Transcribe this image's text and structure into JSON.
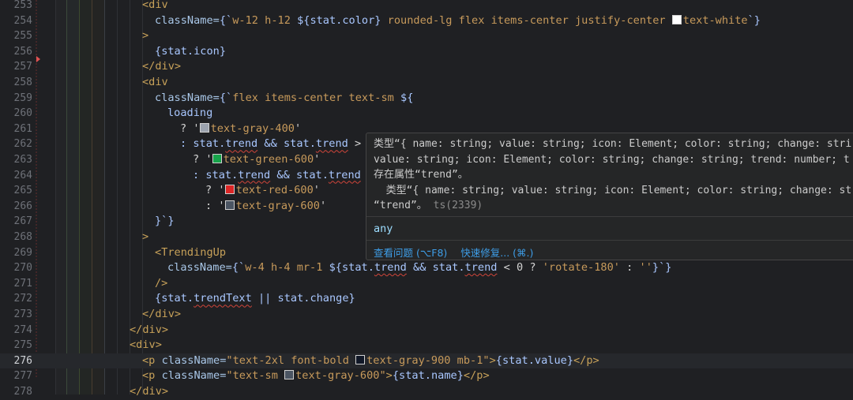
{
  "colors": {
    "editor_bg": "#1f2023",
    "tag": "#c7a159",
    "attr": "#a9c7e8",
    "string": "#c79a5b",
    "variable": "#a9c7ff",
    "error": "#d1453a",
    "link": "#3e9ee8"
  },
  "editor": {
    "active_line": 276,
    "lines": [
      {
        "no": "253",
        "segments": [
          {
            "t": "<div",
            "c": "tag"
          }
        ],
        "indent": 180
      },
      {
        "no": "254",
        "segments": [
          {
            "t": "className=",
            "c": "attr"
          },
          {
            "t": "{`",
            "c": "brace"
          },
          {
            "t": "w-12 h-12 ",
            "c": "str"
          },
          {
            "t": "${",
            "c": "brace"
          },
          {
            "t": "stat.color",
            "c": "var"
          },
          {
            "t": "}",
            "c": "brace"
          },
          {
            "t": " rounded-lg flex items-center justify-center ",
            "c": "str"
          },
          {
            "t": "",
            "c": "swatch",
            "swatch": "#ffffff"
          },
          {
            "t": "text-white",
            "c": "str"
          },
          {
            "t": "`}",
            "c": "brace"
          }
        ],
        "indent": 196
      },
      {
        "no": "255",
        "segments": [
          {
            "t": ">",
            "c": "tag"
          }
        ],
        "indent": 180
      },
      {
        "no": "256",
        "segments": [
          {
            "t": "{",
            "c": "brace"
          },
          {
            "t": "stat.icon",
            "c": "var"
          },
          {
            "t": "}",
            "c": "brace"
          }
        ],
        "indent": 196
      },
      {
        "no": "257",
        "segments": [
          {
            "t": "</div>",
            "c": "tag"
          }
        ],
        "indent": 180
      },
      {
        "no": "258",
        "segments": [
          {
            "t": "<div",
            "c": "tag"
          }
        ],
        "indent": 180
      },
      {
        "no": "259",
        "segments": [
          {
            "t": "className=",
            "c": "attr"
          },
          {
            "t": "{`",
            "c": "brace"
          },
          {
            "t": "flex items-center text-sm ",
            "c": "str"
          },
          {
            "t": "${",
            "c": "brace"
          }
        ],
        "indent": 196
      },
      {
        "no": "260",
        "segments": [
          {
            "t": "loading",
            "c": "var"
          }
        ],
        "indent": 212
      },
      {
        "no": "261",
        "segments": [
          {
            "t": "? '",
            "c": "plain"
          },
          {
            "t": "",
            "c": "swatch",
            "swatch": "#9ca3af"
          },
          {
            "t": "text-gray-400",
            "c": "str"
          },
          {
            "t": "'",
            "c": "plain"
          }
        ],
        "indent": 228
      },
      {
        "no": "262",
        "segments": [
          {
            "t": ": stat.",
            "c": "var"
          },
          {
            "t": "trend",
            "c": "var",
            "sq": true
          },
          {
            "t": " && stat.",
            "c": "var"
          },
          {
            "t": "trend",
            "c": "var",
            "sq": true
          },
          {
            "t": " > 0",
            "c": "plain"
          }
        ],
        "indent": 228
      },
      {
        "no": "263",
        "segments": [
          {
            "t": "? '",
            "c": "plain"
          },
          {
            "t": "",
            "c": "swatch",
            "swatch": "#16a34a"
          },
          {
            "t": "text-green-600",
            "c": "str"
          },
          {
            "t": "'",
            "c": "plain"
          }
        ],
        "indent": 244
      },
      {
        "no": "264",
        "segments": [
          {
            "t": ": stat.",
            "c": "var"
          },
          {
            "t": "trend",
            "c": "var",
            "sq": true
          },
          {
            "t": " && stat.",
            "c": "var"
          },
          {
            "t": "trend",
            "c": "var",
            "sq": true
          },
          {
            "t": " <",
            "c": "plain"
          }
        ],
        "indent": 244
      },
      {
        "no": "265",
        "segments": [
          {
            "t": "? '",
            "c": "plain"
          },
          {
            "t": "",
            "c": "swatch",
            "swatch": "#dc2626"
          },
          {
            "t": "text-red-600",
            "c": "str"
          },
          {
            "t": "'",
            "c": "plain"
          }
        ],
        "indent": 260
      },
      {
        "no": "266",
        "segments": [
          {
            "t": ": '",
            "c": "plain"
          },
          {
            "t": "",
            "c": "swatch",
            "swatch": "#4b5563"
          },
          {
            "t": "text-gray-600",
            "c": "str"
          },
          {
            "t": "'",
            "c": "plain"
          }
        ],
        "indent": 260
      },
      {
        "no": "267",
        "segments": [
          {
            "t": "}`}",
            "c": "brace"
          }
        ],
        "indent": 196
      },
      {
        "no": "268",
        "segments": [
          {
            "t": ">",
            "c": "tag"
          }
        ],
        "indent": 180
      },
      {
        "no": "269",
        "segments": [
          {
            "t": "<TrendingUp",
            "c": "tag"
          }
        ],
        "indent": 196
      },
      {
        "no": "270",
        "segments": [
          {
            "t": "className=",
            "c": "attr"
          },
          {
            "t": "{`",
            "c": "brace"
          },
          {
            "t": "w-4 h-4 mr-1 ",
            "c": "str"
          },
          {
            "t": "${",
            "c": "brace"
          },
          {
            "t": "stat.",
            "c": "var"
          },
          {
            "t": "trend",
            "c": "var",
            "sq": true
          },
          {
            "t": " && stat.",
            "c": "var"
          },
          {
            "t": "trend",
            "c": "var",
            "sq": true
          },
          {
            "t": " < 0 ? ",
            "c": "plain"
          },
          {
            "t": "'rotate-180'",
            "c": "str"
          },
          {
            "t": " : ",
            "c": "plain"
          },
          {
            "t": "''",
            "c": "str"
          },
          {
            "t": "}`}",
            "c": "brace"
          }
        ],
        "indent": 212
      },
      {
        "no": "271",
        "segments": [
          {
            "t": "/>",
            "c": "tag"
          }
        ],
        "indent": 196
      },
      {
        "no": "272",
        "segments": [
          {
            "t": "{",
            "c": "brace"
          },
          {
            "t": "stat.",
            "c": "var"
          },
          {
            "t": "trendText",
            "c": "var",
            "sq": true
          },
          {
            "t": " || stat.change",
            "c": "var"
          },
          {
            "t": "}",
            "c": "brace"
          }
        ],
        "indent": 196
      },
      {
        "no": "273",
        "segments": [
          {
            "t": "</div>",
            "c": "tag"
          }
        ],
        "indent": 180
      },
      {
        "no": "274",
        "segments": [
          {
            "t": "</div>",
            "c": "tag"
          }
        ],
        "indent": 164
      },
      {
        "no": "275",
        "segments": [
          {
            "t": "<div>",
            "c": "tag"
          }
        ],
        "indent": 164
      },
      {
        "no": "276",
        "segments": [
          {
            "t": "<p ",
            "c": "tag"
          },
          {
            "t": "className=",
            "c": "attr"
          },
          {
            "t": "\"text-2xl font-bold ",
            "c": "str"
          },
          {
            "t": "",
            "c": "swatch",
            "swatch": "#111827"
          },
          {
            "t": "text-gray-900 mb-1\"",
            "c": "str"
          },
          {
            "t": ">",
            "c": "tag"
          },
          {
            "t": "{",
            "c": "brace"
          },
          {
            "t": "stat.value",
            "c": "var"
          },
          {
            "t": "}",
            "c": "brace"
          },
          {
            "t": "</p>",
            "c": "tag"
          }
        ],
        "indent": 180
      },
      {
        "no": "277",
        "segments": [
          {
            "t": "<p ",
            "c": "tag"
          },
          {
            "t": "className=",
            "c": "attr"
          },
          {
            "t": "\"text-sm ",
            "c": "str"
          },
          {
            "t": "",
            "c": "swatch",
            "swatch": "#4b5563"
          },
          {
            "t": "text-gray-600\"",
            "c": "str"
          },
          {
            "t": ">",
            "c": "tag"
          },
          {
            "t": "{",
            "c": "brace"
          },
          {
            "t": "stat.name",
            "c": "var"
          },
          {
            "t": "}",
            "c": "brace"
          },
          {
            "t": "</p>",
            "c": "tag"
          }
        ],
        "indent": 180
      },
      {
        "no": "278",
        "segments": [
          {
            "t": "</div>",
            "c": "tag"
          }
        ],
        "indent": 164
      }
    ]
  },
  "hover": {
    "line1": "类型“{ name: string; value: string; icon: Element; color: string; change: stri",
    "line2": "value: string; icon: Element; color: string; change: string; trend: number; t",
    "line3": "存在属性“trend”。",
    "line4": "  类型“{ name: string; value: string; icon: Element; color: string; change: st",
    "line5_prefix": "“trend”。 ",
    "line5_code": "ts(2339)",
    "type_text": "any",
    "action_view": "查看问题 (⌥F8)",
    "action_fix": "快速修复... (⌘.)"
  }
}
